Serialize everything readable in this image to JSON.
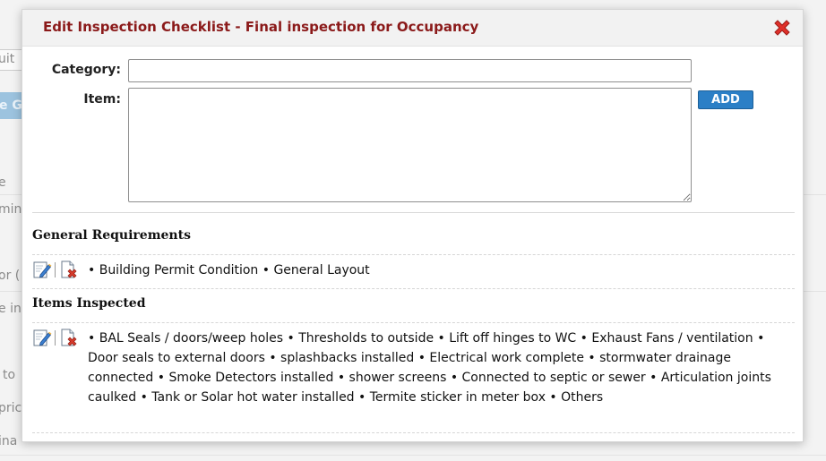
{
  "background": {
    "texts": [
      "uit",
      "e G",
      "e",
      "min",
      "or (",
      "e in",
      "to",
      "pric",
      "ina"
    ]
  },
  "modal": {
    "title": "Edit Inspection Checklist - Final inspection for Occupancy",
    "close_icon": "close-x-icon",
    "form": {
      "category_label": "Category:",
      "category_value": "",
      "item_label": "Item:",
      "item_value": "",
      "add_label": "ADD"
    },
    "sections": [
      {
        "title": "General Requirements",
        "items_text": "• Building Permit Condition • General Layout"
      },
      {
        "title": "Items Inspected",
        "items_text": "• BAL Seals / doors/weep holes • Thresholds to outside • Lift off hinges to WC • Exhaust Fans / ventilation • Door seals to external doors • splashbacks installed • Electrical work complete • stormwater drainage connected • Smoke Detectors installed • shower screens • Connected to septic or sewer • Articulation joints caulked • Tank or Solar hot water installed • Termite sticker in meter box • Others"
      }
    ]
  },
  "colors": {
    "title": "#8b1a1a",
    "add_button": "#2b7fc6",
    "close_icon": "#e0302a"
  }
}
